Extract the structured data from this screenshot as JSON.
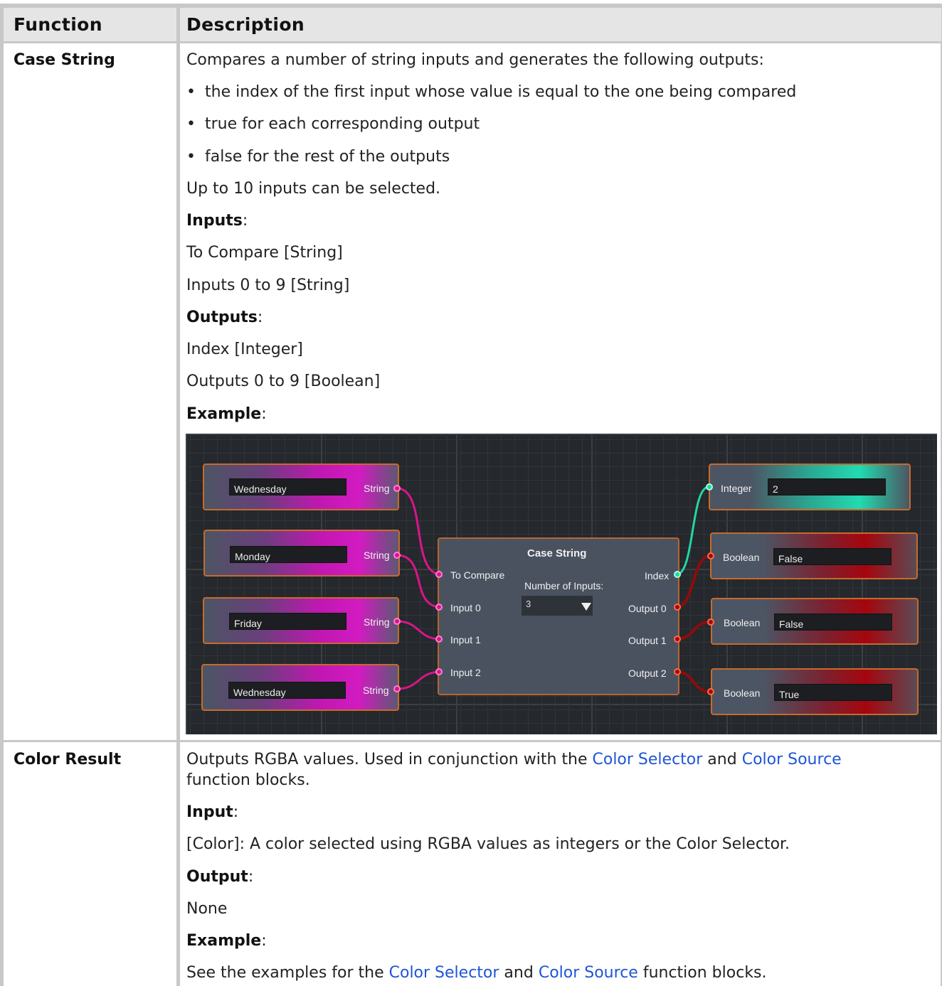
{
  "table": {
    "headers": {
      "function": "Function",
      "description": "Description"
    }
  },
  "case_string": {
    "name": "Case String",
    "intro": "Compares a number of string inputs and generates the following outputs:",
    "bullets": [
      "the index of the first input whose value is equal to the one being compared",
      "true for each corresponding output",
      "false for the rest of the outputs"
    ],
    "note": "Up to 10 inputs can be selected.",
    "inputs_heading": "Inputs",
    "inputs": [
      "To Compare [String]",
      "Inputs 0 to 9 [String]"
    ],
    "outputs_heading": "Outputs",
    "outputs": [
      "Index [Integer]",
      "Outputs 0 to 9 [Boolean]"
    ],
    "example_heading": "Example",
    "example": {
      "string_nodes": [
        {
          "value": "Wednesday",
          "port_label": "String"
        },
        {
          "value": "Monday",
          "port_label": "String"
        },
        {
          "value": "Friday",
          "port_label": "String"
        },
        {
          "value": "Wednesday",
          "port_label": "String"
        }
      ],
      "center": {
        "title": "Case String",
        "inputs": [
          "To Compare",
          "Input 0",
          "Input 1",
          "Input 2"
        ],
        "outputs": [
          "Index",
          "Output 0",
          "Output 1",
          "Output 2"
        ],
        "num_inputs_label": "Number of Inputs:",
        "num_inputs_value": "3"
      },
      "integer_node": {
        "port_label": "Integer",
        "value": "2"
      },
      "boolean_nodes": [
        {
          "port_label": "Boolean",
          "value": "False"
        },
        {
          "port_label": "Boolean",
          "value": "False"
        },
        {
          "port_label": "Boolean",
          "value": "True"
        }
      ],
      "colors": {
        "string_wire": "#d9158a",
        "integer_wire": "#23d6a4",
        "boolean_wire": "#8c0d0d",
        "node_border": "#c86a2c"
      }
    }
  },
  "color_result": {
    "name": "Color Result",
    "desc_before": "Outputs RGBA values. Used in conjunction with the ",
    "link1": "Color Selector",
    "desc_and": " and ",
    "link2": "Color Source",
    "desc_after": "function blocks.",
    "input_heading": "Input",
    "input_text": "[Color]: A color selected using RGBA values as integers or the Color Selector.",
    "output_heading": "Output",
    "output_text": "None",
    "example_heading": "Example",
    "example_before": "See the examples for the ",
    "example_link1": "Color Selector",
    "example_and": " and ",
    "example_link2": "Color Source",
    "example_after": " function blocks."
  }
}
